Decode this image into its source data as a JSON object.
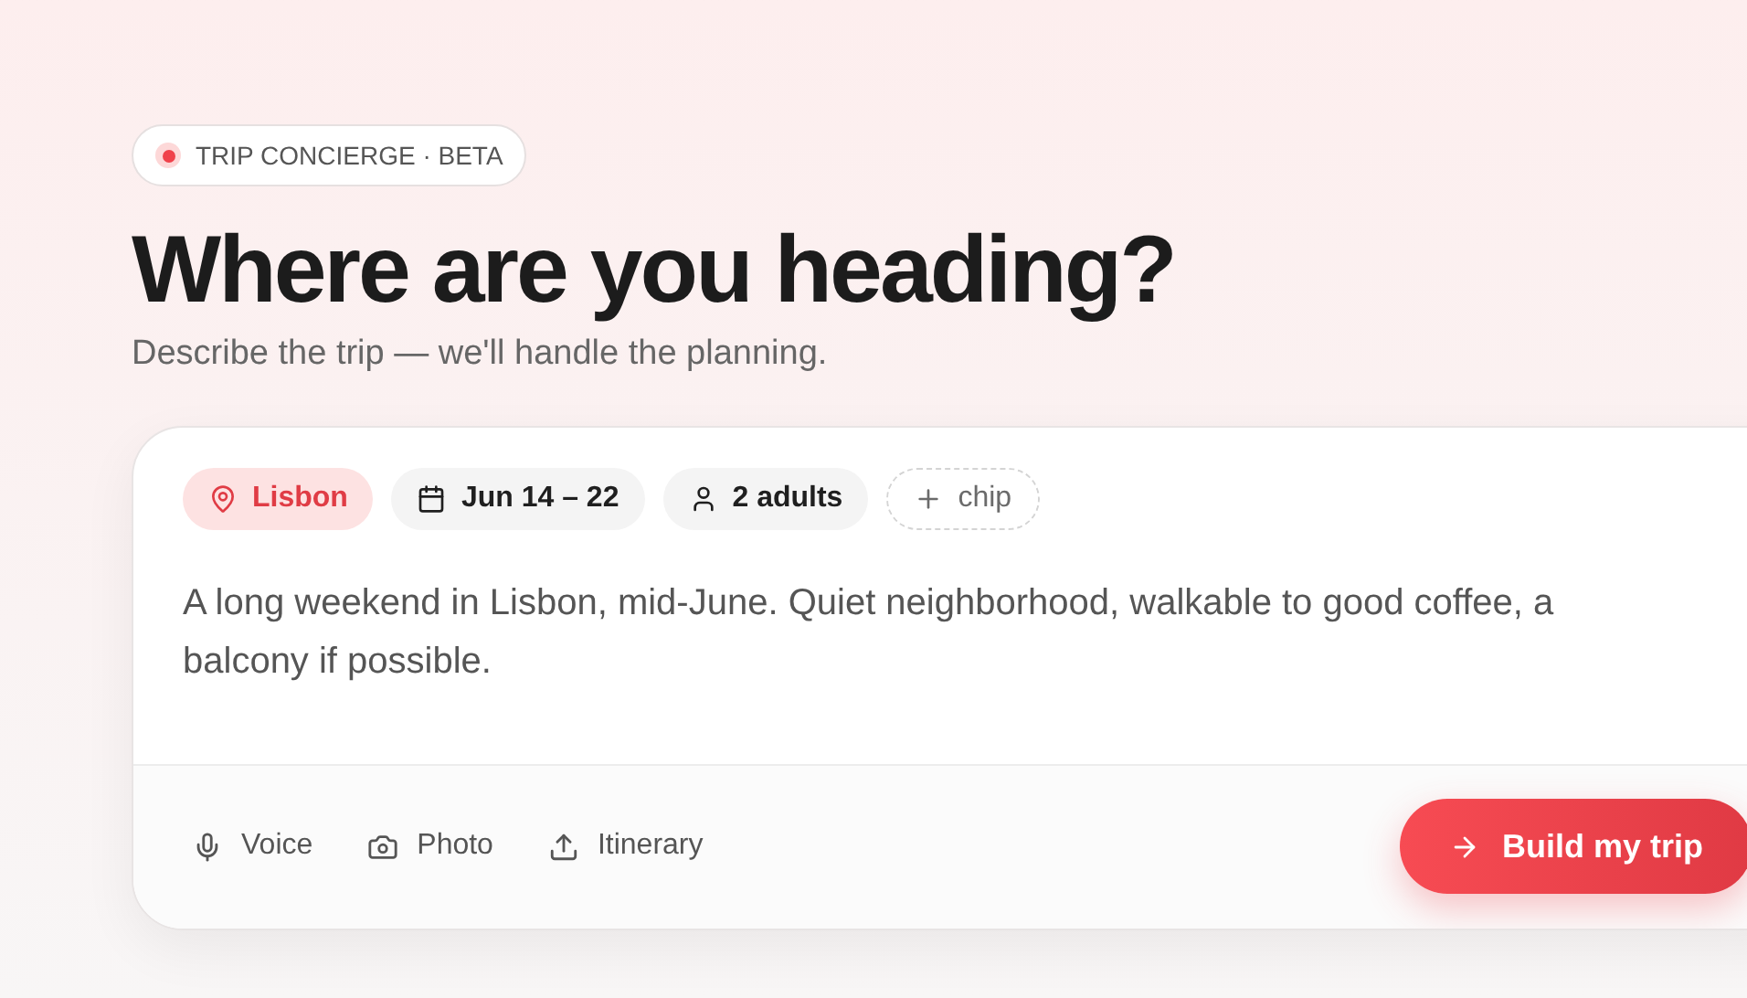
{
  "badge": {
    "label": "TRIP CONCIERGE · BETA"
  },
  "heading": "Where are you heading?",
  "subtitle": "Describe the trip — we'll handle the planning.",
  "chips": [
    {
      "kind": "place",
      "label": "Lisbon"
    },
    {
      "kind": "date",
      "label": "Jun 14 – 22"
    },
    {
      "kind": "people",
      "label": "2 adults"
    },
    {
      "kind": "add",
      "label": "chip"
    }
  ],
  "prompt": "A long weekend in Lisbon, mid-June. Quiet neighborhood, walkable to good coffee, a balcony if possible.",
  "tools": [
    {
      "kind": "voice",
      "label": "Voice"
    },
    {
      "kind": "photo",
      "label": "Photo"
    },
    {
      "kind": "upload",
      "label": "Itinerary"
    }
  ],
  "submit": {
    "label": "Build my trip"
  }
}
